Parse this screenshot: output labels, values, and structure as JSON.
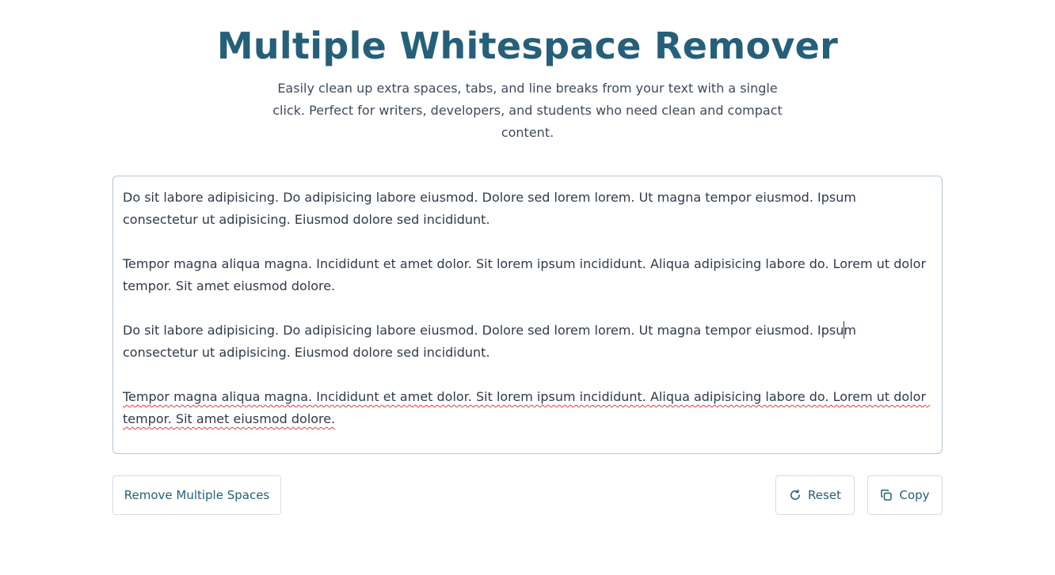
{
  "header": {
    "title": "Multiple Whitespace Remover",
    "subtitle": "Easily clean up extra spaces, tabs, and line breaks from your text with a single click. Perfect for writers, developers, and students who need clean and compact content."
  },
  "editor": {
    "paragraphs": [
      "Do sit labore adipisicing. Do adipisicing labore eiusmod. Dolore sed lorem lorem. Ut magna tempor eiusmod. Ipsum consectetur ut adipisicing. Eiusmod dolore sed incididunt.",
      "Tempor magna aliqua magna. Incididunt et amet dolor. Sit lorem ipsum incididunt. Aliqua adipisicing labore do. Lorem ut dolor tempor. Sit amet eiusmod dolore.",
      "Do sit labore adipisicing. Do adipisicing labore eiusmod. Dolore sed lorem lorem. Ut magna tempor eiusmod. Ipsum consectetur ut adipisicing. Eiusmod dolore sed incididunt.",
      "Tempor magna aliqua magna. Incididunt et amet dolor. Sit lorem ipsum incididunt. Aliqua adipisicing labore do. Lorem ut dolor tempor. Sit amet eiusmod dolore."
    ]
  },
  "actions": {
    "remove_label": "Remove Multiple Spaces",
    "reset_label": "Reset",
    "reset_icon": "refresh-icon",
    "copy_label": "Copy",
    "copy_icon": "copy-icon"
  },
  "colors": {
    "accent": "#255f7a",
    "body_text": "#2f3a4a",
    "editor_border": "#b3c6d3",
    "spellcheck": "#e03b3b"
  }
}
